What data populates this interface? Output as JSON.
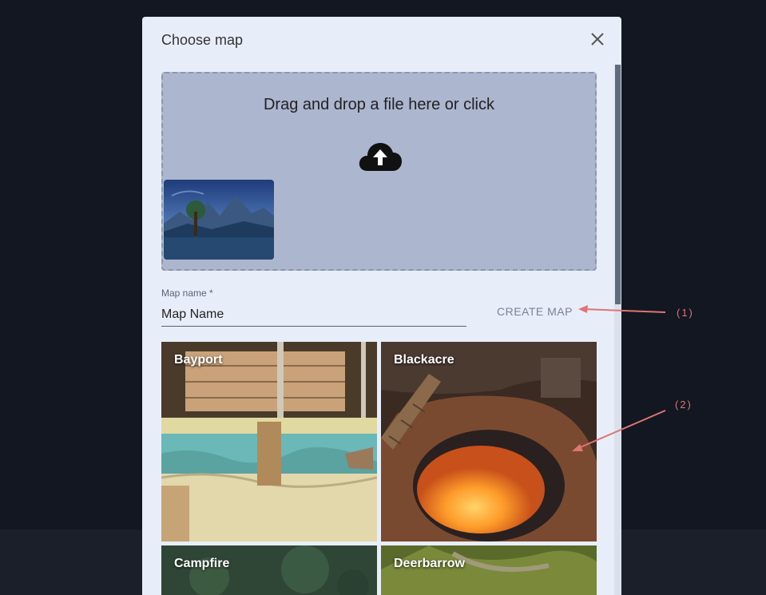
{
  "dialog": {
    "title": "Choose map",
    "close_icon": "close-icon"
  },
  "dropzone": {
    "text": "Drag and drop a file here or click",
    "icon": "cloud-upload-icon"
  },
  "form": {
    "label": "Map name *",
    "value": "Map Name",
    "create_label": "CREATE MAP"
  },
  "maps": [
    {
      "name": "Bayport"
    },
    {
      "name": "Blackacre"
    },
    {
      "name": "Campfire"
    },
    {
      "name": "Deerbarrow"
    }
  ],
  "annotations": {
    "one": "(1)",
    "two": "(2)",
    "color": "#e07474"
  },
  "colors": {
    "dialog_bg": "#e8eef9",
    "page_bg": "#121722",
    "dropzone_bg": "#acb6cf"
  }
}
